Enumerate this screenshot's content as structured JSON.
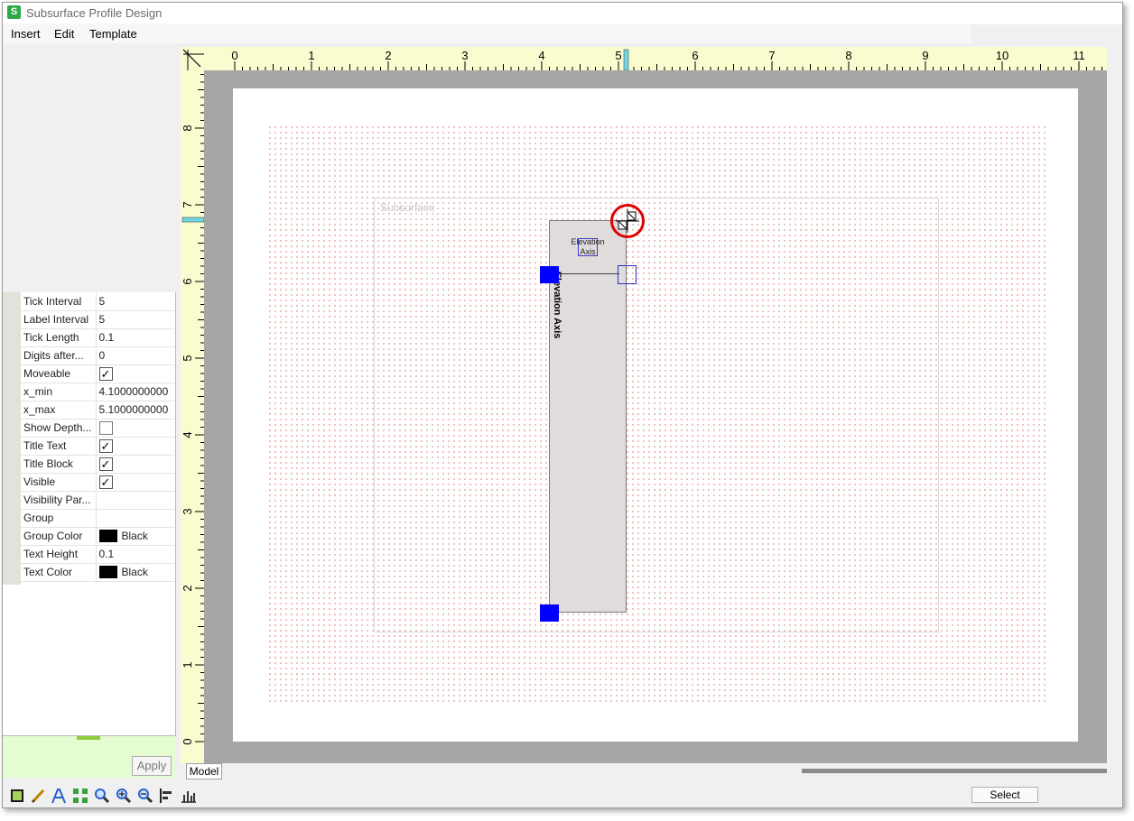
{
  "window": {
    "title": "Subsurface Profile Design",
    "app_icon_glyph": "S"
  },
  "menu": [
    "Insert",
    "Edit",
    "Template"
  ],
  "properties": [
    {
      "name": "Tick Interval",
      "type": "text",
      "value": "5"
    },
    {
      "name": "Label Interval",
      "type": "text",
      "value": "5"
    },
    {
      "name": "Tick Length",
      "type": "text",
      "value": "0.1"
    },
    {
      "name": "Digits after...",
      "type": "text",
      "value": "0"
    },
    {
      "name": "Moveable",
      "type": "check",
      "checked": true
    },
    {
      "name": "x_min",
      "type": "text",
      "value": "4.1000000000"
    },
    {
      "name": "x_max",
      "type": "text",
      "value": "5.1000000000"
    },
    {
      "name": "Show Depth...",
      "type": "check",
      "checked": false
    },
    {
      "name": "Title Text",
      "type": "check",
      "checked": true
    },
    {
      "name": "Title Block",
      "type": "check",
      "checked": true
    },
    {
      "name": "Visible",
      "type": "check",
      "checked": true
    },
    {
      "name": "Visibility Par...",
      "type": "text",
      "value": ""
    },
    {
      "name": "Group",
      "type": "text",
      "value": ""
    },
    {
      "name": "Group Color",
      "type": "color",
      "value": "Black",
      "color": "#000000"
    },
    {
      "name": "Text Height",
      "type": "text",
      "value": "0.1"
    },
    {
      "name": "Text Color",
      "type": "color",
      "value": "Black",
      "color": "#000000"
    }
  ],
  "apply_label": "Apply",
  "ruler": {
    "horizontal_labels": [
      "0",
      "1",
      "2",
      "3",
      "4",
      "5",
      "6",
      "7",
      "8",
      "9",
      "10",
      "11"
    ],
    "vertical_labels": [
      "8",
      "7",
      "6",
      "5",
      "4",
      "3",
      "2",
      "1",
      "0"
    ]
  },
  "canvas": {
    "frame_label": "Subsurface",
    "axis_title_top_line1": "Elevation",
    "axis_title_top_line2": "Axis",
    "axis_title_vertical": "Elevation Axis"
  },
  "tabs": {
    "model": "Model"
  },
  "toolbar": {
    "icons": [
      "select-rect-icon",
      "pencil-icon",
      "text-icon",
      "zoom-extents-icon",
      "zoom-icon",
      "zoom-in-icon",
      "zoom-out-icon",
      "align-left-icon",
      "chart-icon"
    ]
  },
  "status": {
    "mode_label": "Select"
  }
}
